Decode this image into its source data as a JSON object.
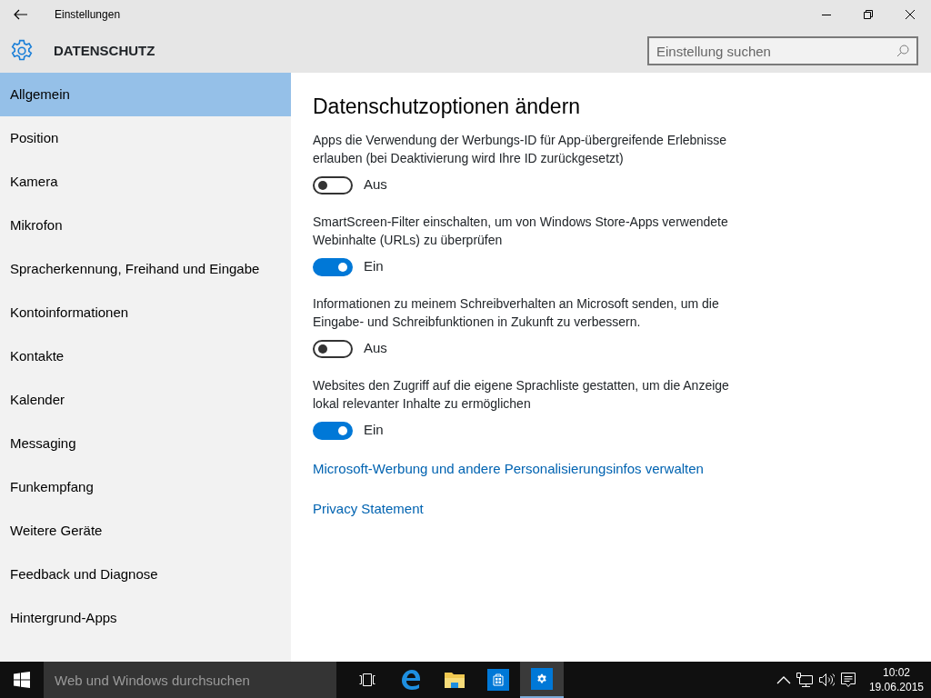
{
  "window": {
    "title": "Einstellungen"
  },
  "header": {
    "title": "DATENSCHUTZ",
    "search": {
      "placeholder": "Einstellung suchen"
    }
  },
  "sidebar": {
    "items": [
      {
        "label": "Allgemein",
        "selected": true
      },
      {
        "label": "Position",
        "selected": false
      },
      {
        "label": "Kamera",
        "selected": false
      },
      {
        "label": "Mikrofon",
        "selected": false
      },
      {
        "label": "Spracherkennung, Freihand und Eingabe",
        "selected": false
      },
      {
        "label": "Kontoinformationen",
        "selected": false
      },
      {
        "label": "Kontakte",
        "selected": false
      },
      {
        "label": "Kalender",
        "selected": false
      },
      {
        "label": "Messaging",
        "selected": false
      },
      {
        "label": "Funkempfang",
        "selected": false
      },
      {
        "label": "Weitere Geräte",
        "selected": false
      },
      {
        "label": "Feedback und Diagnose",
        "selected": false
      },
      {
        "label": "Hintergrund-Apps",
        "selected": false
      }
    ]
  },
  "content": {
    "heading": "Datenschutzoptionen ändern",
    "settings": [
      {
        "description": "Apps die Verwendung der Werbungs-ID für App-übergreifende Erlebnisse erlauben (bei Deaktivierung wird Ihre ID zurückgesetzt)",
        "on": false,
        "state_label": "Aus"
      },
      {
        "description": "SmartScreen-Filter einschalten, um von Windows Store-Apps verwendete Webinhalte (URLs) zu überprüfen",
        "on": true,
        "state_label": "Ein"
      },
      {
        "description": "Informationen zu meinem Schreibverhalten an Microsoft senden, um die Eingabe- und Schreibfunktionen in Zukunft zu verbessern.",
        "on": false,
        "state_label": "Aus"
      },
      {
        "description": "Websites den Zugriff auf die eigene Sprachliste gestatten, um die Anzeige lokal relevanter Inhalte zu ermöglichen",
        "on": true,
        "state_label": "Ein"
      }
    ],
    "links": [
      "Microsoft-Werbung und andere Personalisierungsinfos verwalten",
      "Privacy Statement"
    ]
  },
  "taskbar": {
    "search": {
      "placeholder": "Web und Windows durchsuchen"
    },
    "apps": [
      {
        "kind": "taskview",
        "selected": false
      },
      {
        "kind": "edge",
        "selected": false
      },
      {
        "kind": "explorer",
        "selected": false
      },
      {
        "kind": "store",
        "selected": false
      },
      {
        "kind": "settings",
        "selected": true
      }
    ],
    "time": "10:02",
    "date": "19.06.2015"
  }
}
